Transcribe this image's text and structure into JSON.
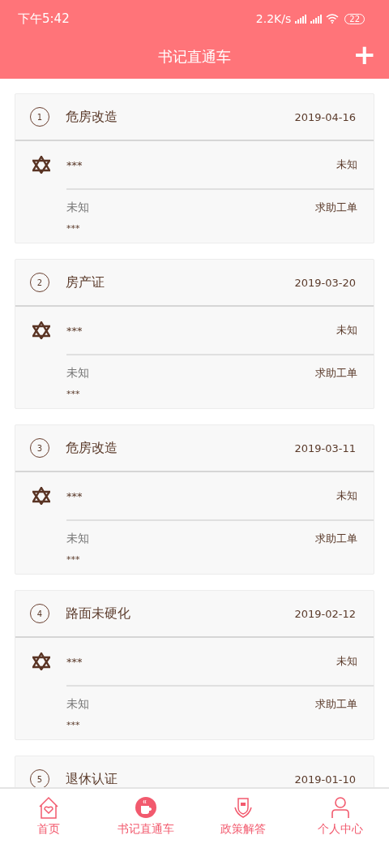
{
  "status_bar": {
    "time": "下午5:42",
    "speed": "2.2K/s",
    "battery": "22"
  },
  "app_bar": {
    "title": "书记直通车",
    "action": "+"
  },
  "cards": [
    {
      "number": "1",
      "title": "危房改造",
      "date": "2019-04-16",
      "name": "***",
      "status": "未知",
      "category": "未知",
      "type": "求助工单",
      "note": "***"
    },
    {
      "number": "2",
      "title": "房产证",
      "date": "2019-03-20",
      "name": "***",
      "status": "未知",
      "category": "未知",
      "type": "求助工单",
      "note": "***"
    },
    {
      "number": "3",
      "title": "危房改造",
      "date": "2019-03-11",
      "name": "***",
      "status": "未知",
      "category": "未知",
      "type": "求助工单",
      "note": "***"
    },
    {
      "number": "4",
      "title": "路面未硬化",
      "date": "2019-02-12",
      "name": "***",
      "status": "未知",
      "category": "未知",
      "type": "求助工单",
      "note": "***"
    },
    {
      "number": "5",
      "title": "退休认证",
      "date": "2019-01-10"
    }
  ],
  "tab_bar": [
    {
      "kind": "home",
      "label": "首页",
      "selected": false
    },
    {
      "kind": "cup",
      "label": "书记直通车",
      "selected": true
    },
    {
      "kind": "shield",
      "label": "政策解答",
      "selected": false
    },
    {
      "kind": "person",
      "label": "个人中心",
      "selected": false
    }
  ]
}
